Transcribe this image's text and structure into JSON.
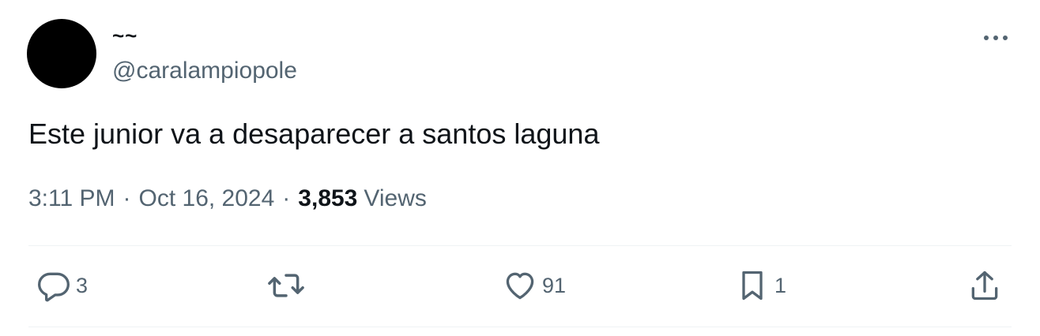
{
  "tweet": {
    "display_name": "~~",
    "handle": "@caralampiopole",
    "text": "Este junior va a desaparecer a santos laguna",
    "time": "3:11 PM",
    "separator": "·",
    "date": "Oct 16, 2024",
    "views_count": "3,853",
    "views_label": "Views"
  },
  "actions": {
    "reply": {
      "icon": "reply-icon",
      "count": "3"
    },
    "retweet": {
      "icon": "retweet-icon",
      "count": ""
    },
    "like": {
      "icon": "heart-icon",
      "count": "91"
    },
    "bookmark": {
      "icon": "bookmark-icon",
      "count": "1"
    },
    "share": {
      "icon": "share-icon",
      "count": ""
    }
  },
  "colors": {
    "text_primary": "#0f1419",
    "text_secondary": "#536471",
    "divider": "#eff3f4",
    "avatar": "#000000"
  }
}
